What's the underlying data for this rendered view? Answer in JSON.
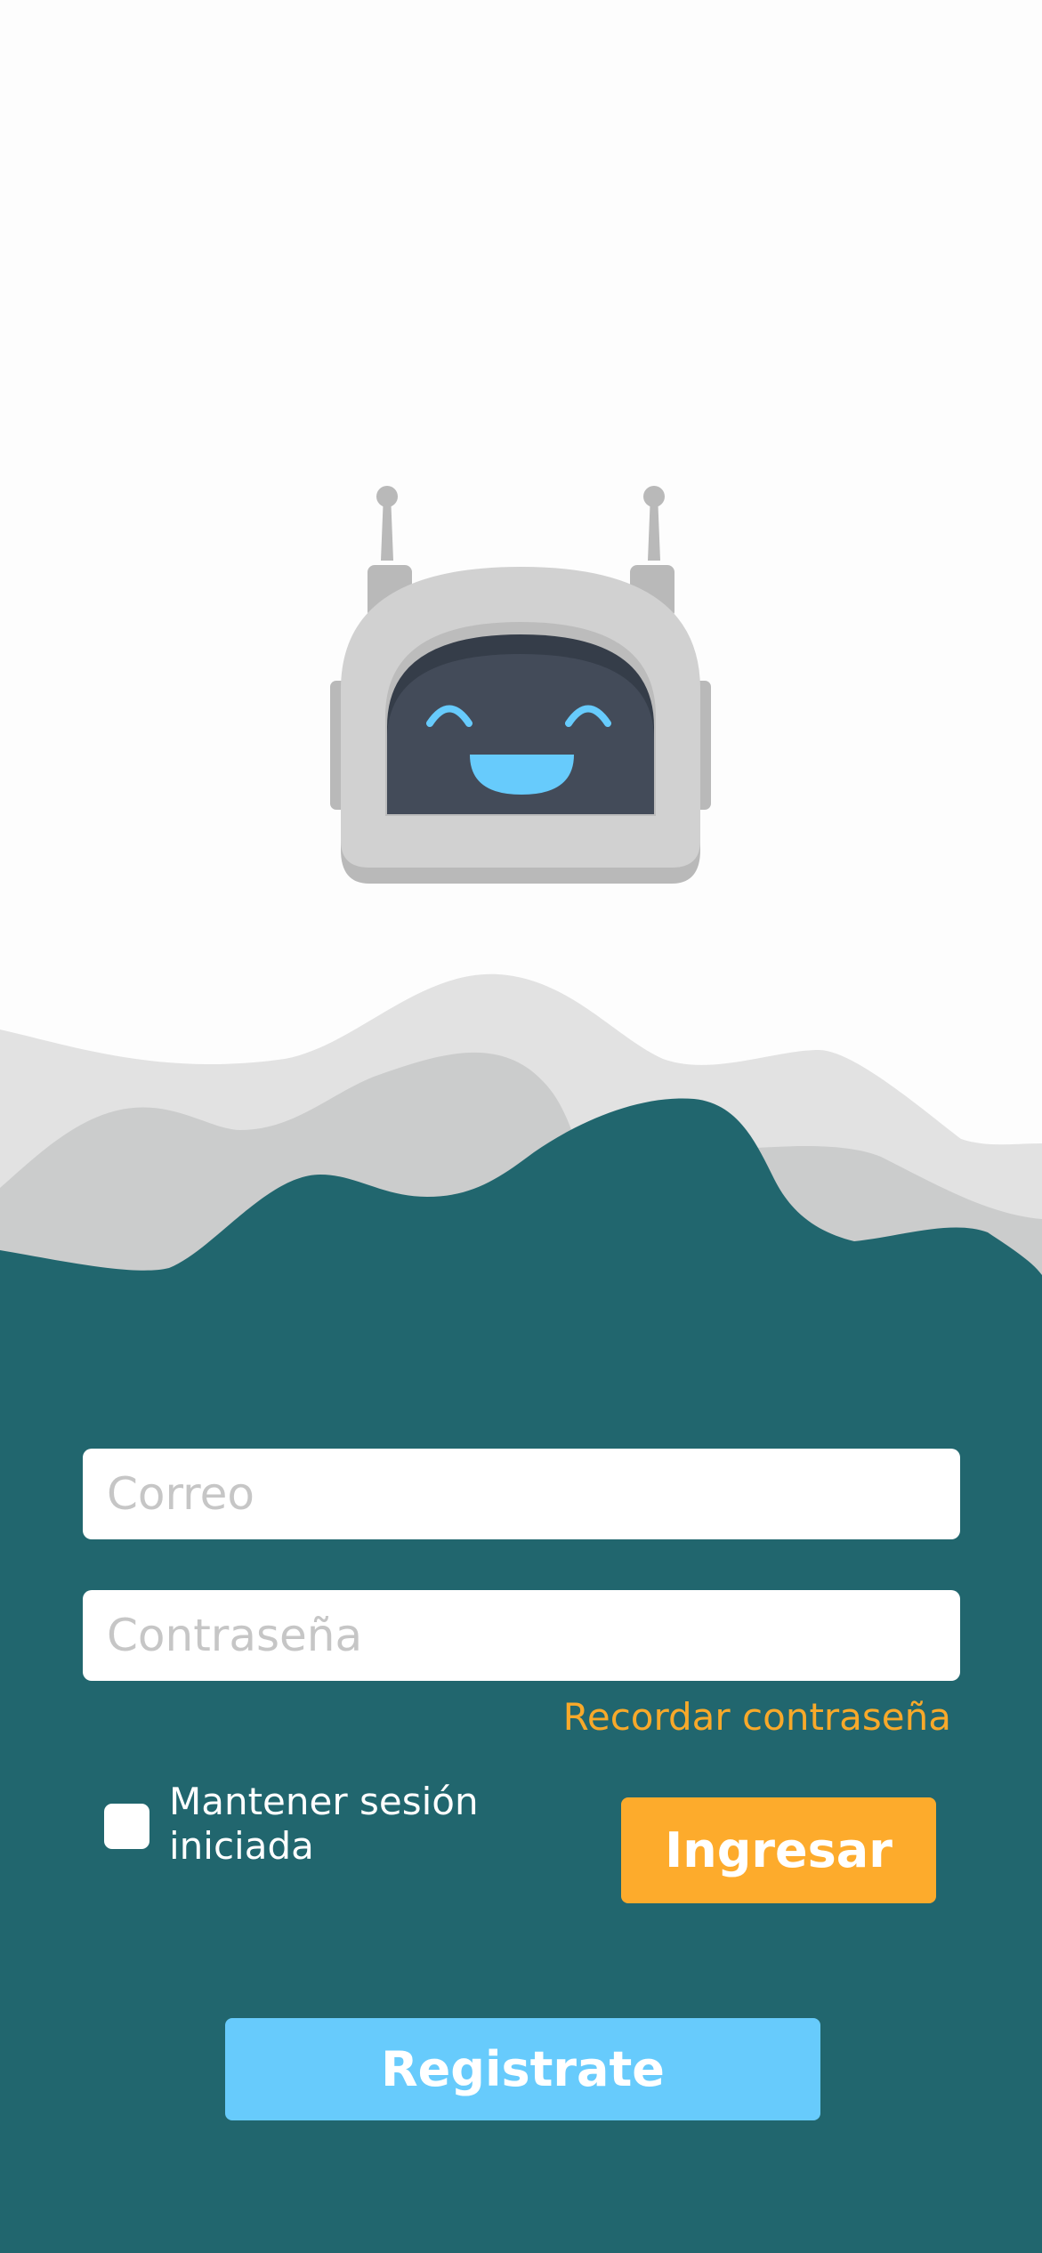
{
  "app": {
    "mascot_icon": "smiling-robot-icon"
  },
  "login_form": {
    "email_placeholder": "Correo",
    "password_placeholder": "Contraseña",
    "forgot_password_label": "Recordar contraseña",
    "remember_me_label": "Mantener sesión iniciada",
    "remember_me_checked": false,
    "login_button_label": "Ingresar",
    "register_button_label": "Registrate"
  },
  "colors": {
    "background": "#fdfdfd",
    "form_background": "#21666e",
    "accent_orange": "#fdab2c",
    "accent_blue": "#67cbfc",
    "wave_light": "#e2e2e2",
    "wave_mid": "#cbcccc"
  }
}
